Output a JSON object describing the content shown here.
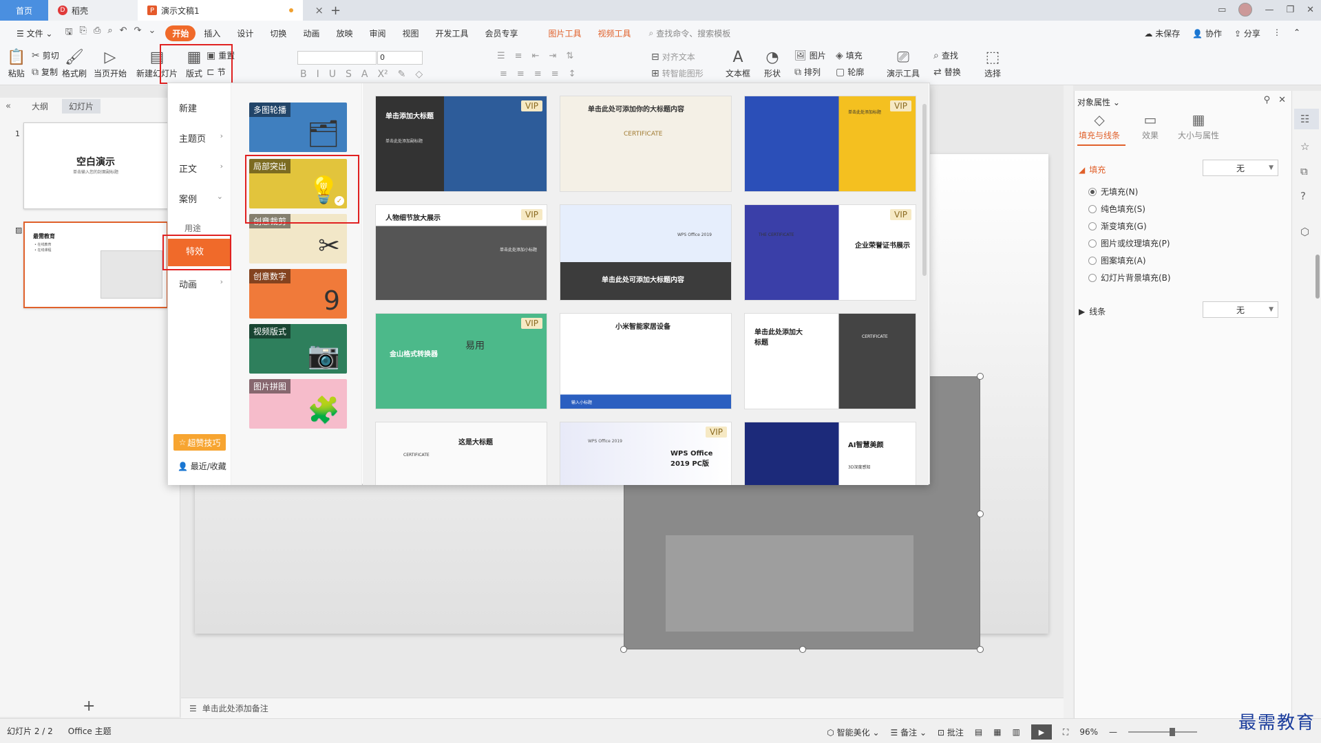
{
  "tabs": {
    "home": "首页",
    "draft": "稻壳",
    "doc": "演示文稿1",
    "doc_logo": "P",
    "draft_logo": "D",
    "add": "+",
    "close": "×"
  },
  "menubar": {
    "file": "文件",
    "items": [
      "开始",
      "插入",
      "设计",
      "切换",
      "动画",
      "放映",
      "审阅",
      "视图",
      "开发工具",
      "会员专享"
    ],
    "tool_items": [
      "图片工具",
      "视频工具"
    ],
    "search": "查找命令、搜索模板",
    "right": [
      "未保存",
      "协作",
      "分享"
    ]
  },
  "ribbon": {
    "paste": "粘贴",
    "cut": "剪切",
    "copy": "复制",
    "format_painter": "格式刷",
    "from_current": "当页开始",
    "new_slide": "新建幻灯片",
    "layout": "版式",
    "reset": "重置",
    "section": "节",
    "font_size": "0",
    "align_text": "对齐文本",
    "smart_art": "转智能图形",
    "textbox": "文本框",
    "shape": "形状",
    "picture": "图片",
    "fill": "填充",
    "arrange": "排列",
    "outline": "轮廓",
    "present_tool": "演示工具",
    "find": "查找",
    "replace": "替换",
    "select": "选择"
  },
  "slide_panel": {
    "outline_tab": "大纲",
    "slides_tab": "幻灯片",
    "slide1_num": "1",
    "slide1_title": "空白演示",
    "slide1_sub": "单击输入您的封面副标题",
    "slide2_title": "最需教育",
    "slide2_lines": [
      "• 在线教育",
      "• 在线课程"
    ]
  },
  "gallery": {
    "categories": {
      "new": "新建",
      "theme": "主题页",
      "body": "正文",
      "cases": "案例",
      "usage": "用途",
      "effects": "特效",
      "animation": "动画"
    },
    "tips": "超赞技巧",
    "recent": "最近/收藏",
    "subcats": [
      "多图轮播",
      "局部突出",
      "创意裁剪",
      "创意数字",
      "视频版式",
      "图片拼图"
    ],
    "vip_label": "VIP",
    "templates": [
      {
        "title": "单击添加大标题",
        "sub": "单击此处添加副标题"
      },
      {
        "title": "单击此处可添加你的大标题内容",
        "sub": "CERTIFICATE"
      },
      {
        "title": "",
        "sub": "单击此处添加标题"
      },
      {
        "title": "人物细节放大展示",
        "sub": "单击此处添加小标题"
      },
      {
        "title": "单击此处可添加大标题内容",
        "sub": "WPS Office 2019"
      },
      {
        "title": "企业荣誉证书展示",
        "sub": "THE CERTIFICATE"
      },
      {
        "title": "金山格式转换器",
        "sub": "易用"
      },
      {
        "title": "小米智能家居设备",
        "sub": "输入小标题"
      },
      {
        "title": "单击此处添加大标题",
        "sub": "CERTIFICATE"
      },
      {
        "title": "这是大标题",
        "sub": "CERTIFICATE"
      },
      {
        "title": "WPS Office 2019 PC版",
        "sub": "WPS Office 2019"
      },
      {
        "title": "AI智慧美颜",
        "sub": "3D深度感知"
      }
    ]
  },
  "props": {
    "title": "对象属性",
    "tabs": [
      "填充与线条",
      "效果",
      "大小与属性"
    ],
    "fill_section": "填充",
    "fill_value": "无",
    "fill_options": [
      "无填充(N)",
      "纯色填充(S)",
      "渐变填充(G)",
      "图片或纹理填充(P)",
      "图案填充(A)",
      "幻灯片背景填充(B)"
    ],
    "line_section": "线条",
    "line_value": "无"
  },
  "notes": "单击此处添加备注",
  "status": {
    "slide_count": "幻灯片 2 / 2",
    "theme": "Office 主题",
    "beautify": "智能美化",
    "notes": "备注",
    "comments": "批注",
    "zoom": "96%"
  },
  "watermark": "最需教育",
  "colors": {
    "accent": "#f06a2a",
    "home_tab": "#4a8fe0",
    "highlight_box": "#e02020"
  }
}
